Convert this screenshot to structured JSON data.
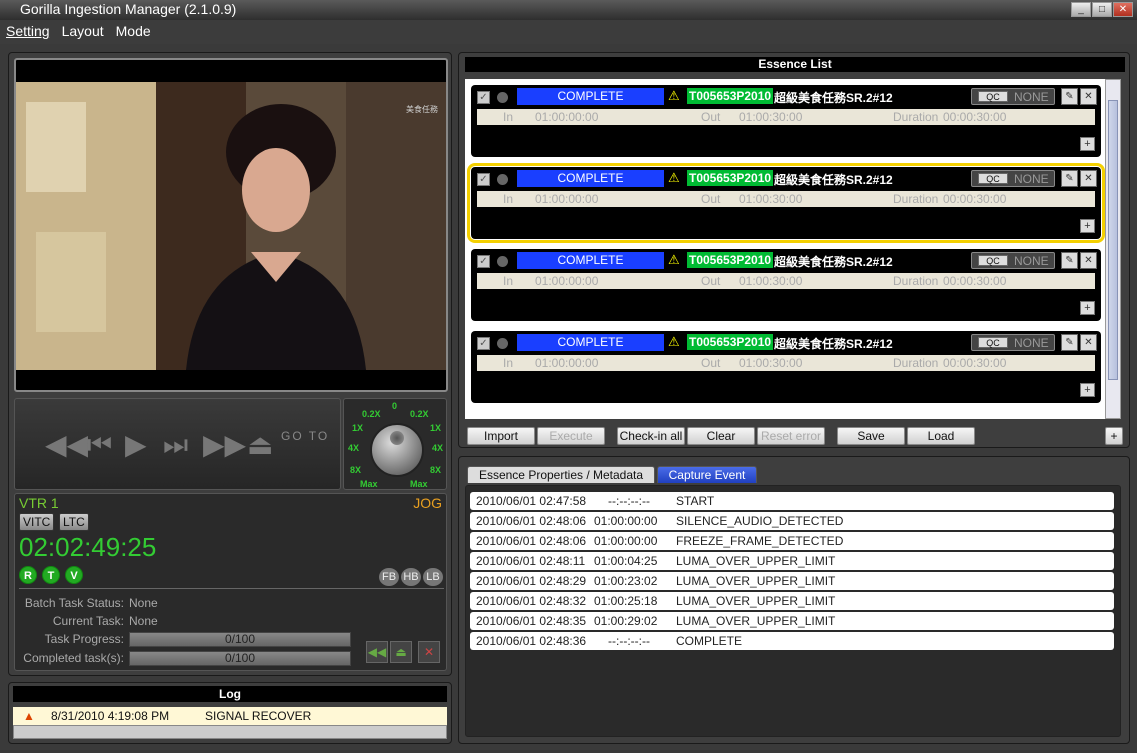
{
  "window": {
    "title": "Gorilla Ingestion Manager (2.1.0.9)"
  },
  "menu": [
    "Setting",
    "Layout",
    "Mode"
  ],
  "video": {
    "caption": "美食任務"
  },
  "transport": {
    "goto_label": "GO TO",
    "buttons": [
      "rewind",
      "prev",
      "play",
      "next",
      "fast-forward",
      "eject"
    ]
  },
  "jog": {
    "labels": {
      "zero": "0",
      "tl": "0.2X",
      "tr": "0.2X",
      "l1": "1X",
      "r1": "1X",
      "l4": "4X",
      "r4": "4X",
      "l8": "8X",
      "r8": "8X",
      "lmax": "Max",
      "rmax": "Max"
    }
  },
  "vtr": {
    "name": "VTR 1",
    "mode": "JOG",
    "vitc": "VITC",
    "ltc": "LTC",
    "timecode": "02:02:49:25",
    "rtv": [
      "R",
      "T",
      "V"
    ],
    "fhl": [
      "FB",
      "HB",
      "LB"
    ],
    "batch_label": "Batch Task Status:",
    "batch_value": "None",
    "current_label": "Current Task:",
    "current_value": "None",
    "progress_label": "Task Progress:",
    "progress_value": "0/100",
    "completed_label": "Completed task(s):",
    "completed_value": "0/100"
  },
  "log": {
    "title": "Log",
    "entries": [
      {
        "time": "8/31/2010 4:19:08 PM",
        "message": "SIGNAL  RECOVER"
      }
    ]
  },
  "essence": {
    "title": "Essence List",
    "items": [
      {
        "status": "COMPLETE",
        "id": "T005653P2010",
        "name": "超級美食任務SR.2#12",
        "qc": "QC",
        "qc_value": "NONE",
        "in_label": "In",
        "in": "01:00:00:00",
        "out_label": "Out",
        "out": "01:00:30:00",
        "dur_label": "Duration",
        "duration": "00:00:30:00"
      },
      {
        "status": "COMPLETE",
        "id": "T005653P2010",
        "name": "超級美食任務SR.2#12",
        "qc": "QC",
        "qc_value": "NONE",
        "in_label": "In",
        "in": "01:00:00:00",
        "out_label": "Out",
        "out": "01:00:30:00",
        "dur_label": "Duration",
        "duration": "00:00:30:00"
      },
      {
        "status": "COMPLETE",
        "id": "T005653P2010",
        "name": "超級美食任務SR.2#12",
        "qc": "QC",
        "qc_value": "NONE",
        "in_label": "In",
        "in": "01:00:00:00",
        "out_label": "Out",
        "out": "01:00:30:00",
        "dur_label": "Duration",
        "duration": "00:00:30:00"
      },
      {
        "status": "COMPLETE",
        "id": "T005653P2010",
        "name": "超級美食任務SR.2#12",
        "qc": "QC",
        "qc_value": "NONE",
        "in_label": "In",
        "in": "01:00:00:00",
        "out_label": "Out",
        "out": "01:00:30:00",
        "dur_label": "Duration",
        "duration": "00:00:30:00"
      }
    ],
    "buttons": {
      "import": "Import",
      "execute": "Execute",
      "checkin": "Check-in all",
      "clear": "Clear",
      "reset": "Reset error",
      "save": "Save",
      "load": "Load",
      "add": "+"
    }
  },
  "tabs": {
    "properties": "Essence Properties / Metadata",
    "capture": "Capture Event"
  },
  "events": [
    {
      "time": "2010/06/01 02:47:58",
      "tc": "--:--:--:--",
      "event": "START"
    },
    {
      "time": "2010/06/01 02:48:06",
      "tc": "01:00:00:00",
      "event": "SILENCE_AUDIO_DETECTED"
    },
    {
      "time": "2010/06/01 02:48:06",
      "tc": "01:00:00:00",
      "event": "FREEZE_FRAME_DETECTED"
    },
    {
      "time": "2010/06/01 02:48:11",
      "tc": "01:00:04:25",
      "event": "LUMA_OVER_UPPER_LIMIT"
    },
    {
      "time": "2010/06/01 02:48:29",
      "tc": "01:00:23:02",
      "event": "LUMA_OVER_UPPER_LIMIT"
    },
    {
      "time": "2010/06/01 02:48:32",
      "tc": "01:00:25:18",
      "event": "LUMA_OVER_UPPER_LIMIT"
    },
    {
      "time": "2010/06/01 02:48:35",
      "tc": "01:00:29:02",
      "event": "LUMA_OVER_UPPER_LIMIT"
    },
    {
      "time": "2010/06/01 02:48:36",
      "tc": "--:--:--:--",
      "event": "COMPLETE"
    }
  ]
}
